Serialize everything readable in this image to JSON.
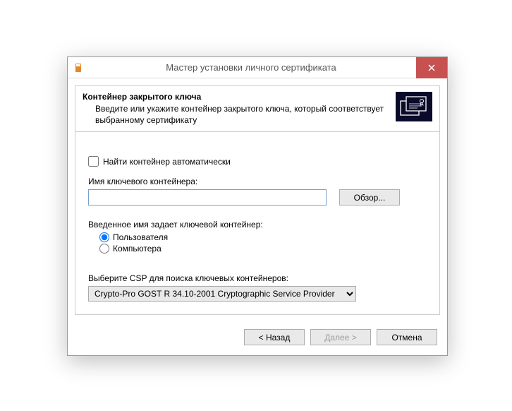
{
  "window": {
    "title": "Мастер установки личного сертификата"
  },
  "header": {
    "title": "Контейнер закрытого ключа",
    "description": "Введите или укажите контейнер закрытого ключа, который соответствует выбранному сертификату"
  },
  "body": {
    "auto_find_label": "Найти контейнер автоматически",
    "auto_find_checked": false,
    "container_name_label": "Имя ключевого контейнера:",
    "container_name_value": "",
    "browse_label": "Обзор...",
    "scope_group_label": "Введенное имя задает ключевой контейнер:",
    "scope_options": [
      {
        "label": "Пользователя",
        "value": "user",
        "checked": true
      },
      {
        "label": "Компьютера",
        "value": "computer",
        "checked": false
      }
    ],
    "csp_label": "Выберите CSP для поиска ключевых контейнеров:",
    "csp_selected": "Crypto-Pro GOST R 34.10-2001 Cryptographic Service Provider"
  },
  "footer": {
    "back_label": "< Назад",
    "next_label": "Далее >",
    "cancel_label": "Отмена",
    "next_enabled": false
  }
}
